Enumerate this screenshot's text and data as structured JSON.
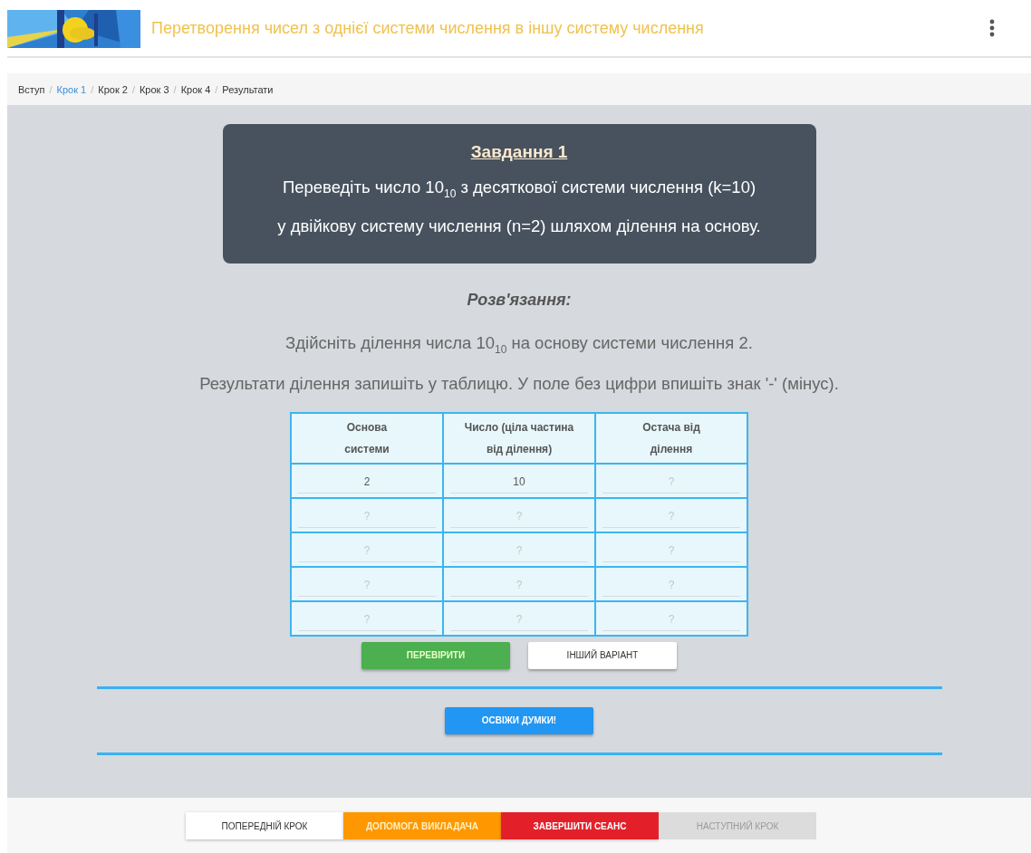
{
  "header": {
    "title": "Перетворення чисел з однієї системи числення в іншу систему числення"
  },
  "breadcrumbs": [
    {
      "label": "Вступ",
      "selected": false
    },
    {
      "separator": "/",
      "label": "Крок 1",
      "selected": true
    },
    {
      "separator": "/",
      "label": "Крок 2",
      "selected": false
    },
    {
      "separator": "/",
      "label": "Крок 3",
      "selected": false
    },
    {
      "separator": "/",
      "label": "Крок 4",
      "selected": false
    },
    {
      "separator": "/",
      "label": "Результати",
      "selected": false
    }
  ],
  "task": {
    "title": "Завдання 1",
    "lines": [
      "Переведіть число 10$_{10}$ з десяткової системи числення (k=10)",
      "у двійкову систему числення (n=2) шляхом ділення на основу."
    ]
  },
  "solution_title": "Розв'язання:",
  "instructions": [
    "Здійсніть ділення числа 10$_{10}$ на основу системи числення 2.",
    "Результати ділення запишіть у таблицю. У поле без цифри впишіть знак '-' (мінус)."
  ],
  "table": {
    "columns": [
      "Основа системи",
      "Число (ціла частина від ділення)",
      "Остача від ділення"
    ],
    "rows": [
      [
        {
          "value": "2"
        },
        {
          "value": "10"
        },
        {
          "placeholder": "?"
        }
      ],
      [
        {
          "placeholder": "?"
        },
        {
          "placeholder": "?"
        },
        {
          "placeholder": "?"
        }
      ],
      [
        {
          "placeholder": "?"
        },
        {
          "placeholder": "?"
        },
        {
          "placeholder": "?"
        }
      ],
      [
        {
          "placeholder": "?"
        },
        {
          "placeholder": "?"
        },
        {
          "placeholder": "?"
        }
      ],
      [
        {
          "placeholder": "?"
        },
        {
          "placeholder": "?"
        },
        {
          "placeholder": "?"
        }
      ]
    ]
  },
  "actions": [
    {
      "label": "ПЕРЕВІРИТИ",
      "kind": "primary"
    },
    {
      "label": "ІНШИЙ ВАРІАНТ",
      "kind": "plain"
    }
  ],
  "refresh_button": "ОСВІЖИ ДУМКИ!",
  "footer_buttons": [
    {
      "label": "ПОПЕРЕДНІЙ КРОК",
      "kind": "plain",
      "disabled": false
    },
    {
      "label": "ДОПОМОГА ВИКЛАДАЧА",
      "kind": "help",
      "disabled": false
    },
    {
      "label": "ЗАВЕРШИТИ СЕАНС",
      "kind": "danger",
      "disabled": false
    },
    {
      "label": "НАСТУПНИЙ КРОК",
      "kind": "plain",
      "disabled": true
    }
  ]
}
